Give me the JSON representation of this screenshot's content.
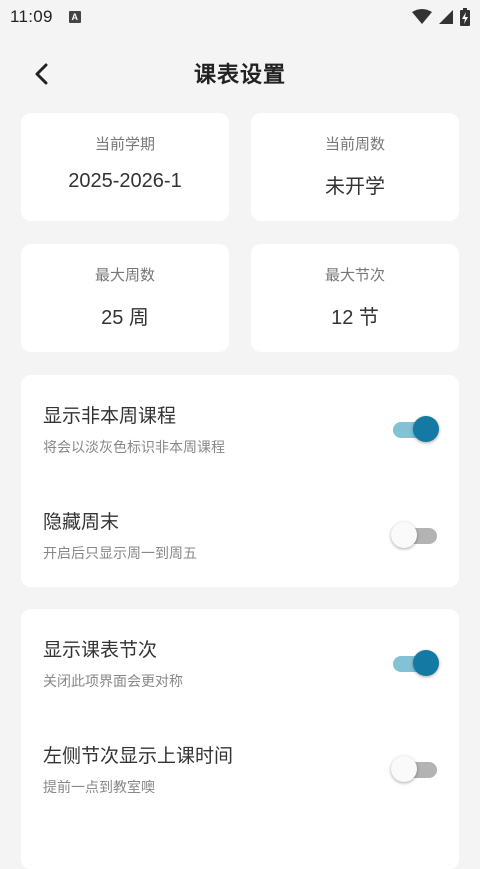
{
  "status": {
    "time": "11:09",
    "notif_icon": "A"
  },
  "header": {
    "title": "课表设置"
  },
  "info": [
    {
      "label": "当前学期",
      "value": "2025-2026-1"
    },
    {
      "label": "当前周数",
      "value": "未开学"
    },
    {
      "label": "最大周数",
      "value": "25 周"
    },
    {
      "label": "最大节次",
      "value": "12 节"
    }
  ],
  "group1": [
    {
      "title": "显示非本周课程",
      "subtitle": "将会以淡灰色标识非本周课程",
      "on": true
    },
    {
      "title": "隐藏周末",
      "subtitle": "开启后只显示周一到周五",
      "on": false
    }
  ],
  "group2": [
    {
      "title": "显示课表节次",
      "subtitle": "关闭此项界面会更对称",
      "on": true
    },
    {
      "title": "左侧节次显示上课时间",
      "subtitle": "提前一点到教室噢",
      "on": false
    }
  ],
  "colors": {
    "accent": "#1479a3",
    "accent_track": "#83c1d6",
    "background": "#f4f4f4"
  }
}
